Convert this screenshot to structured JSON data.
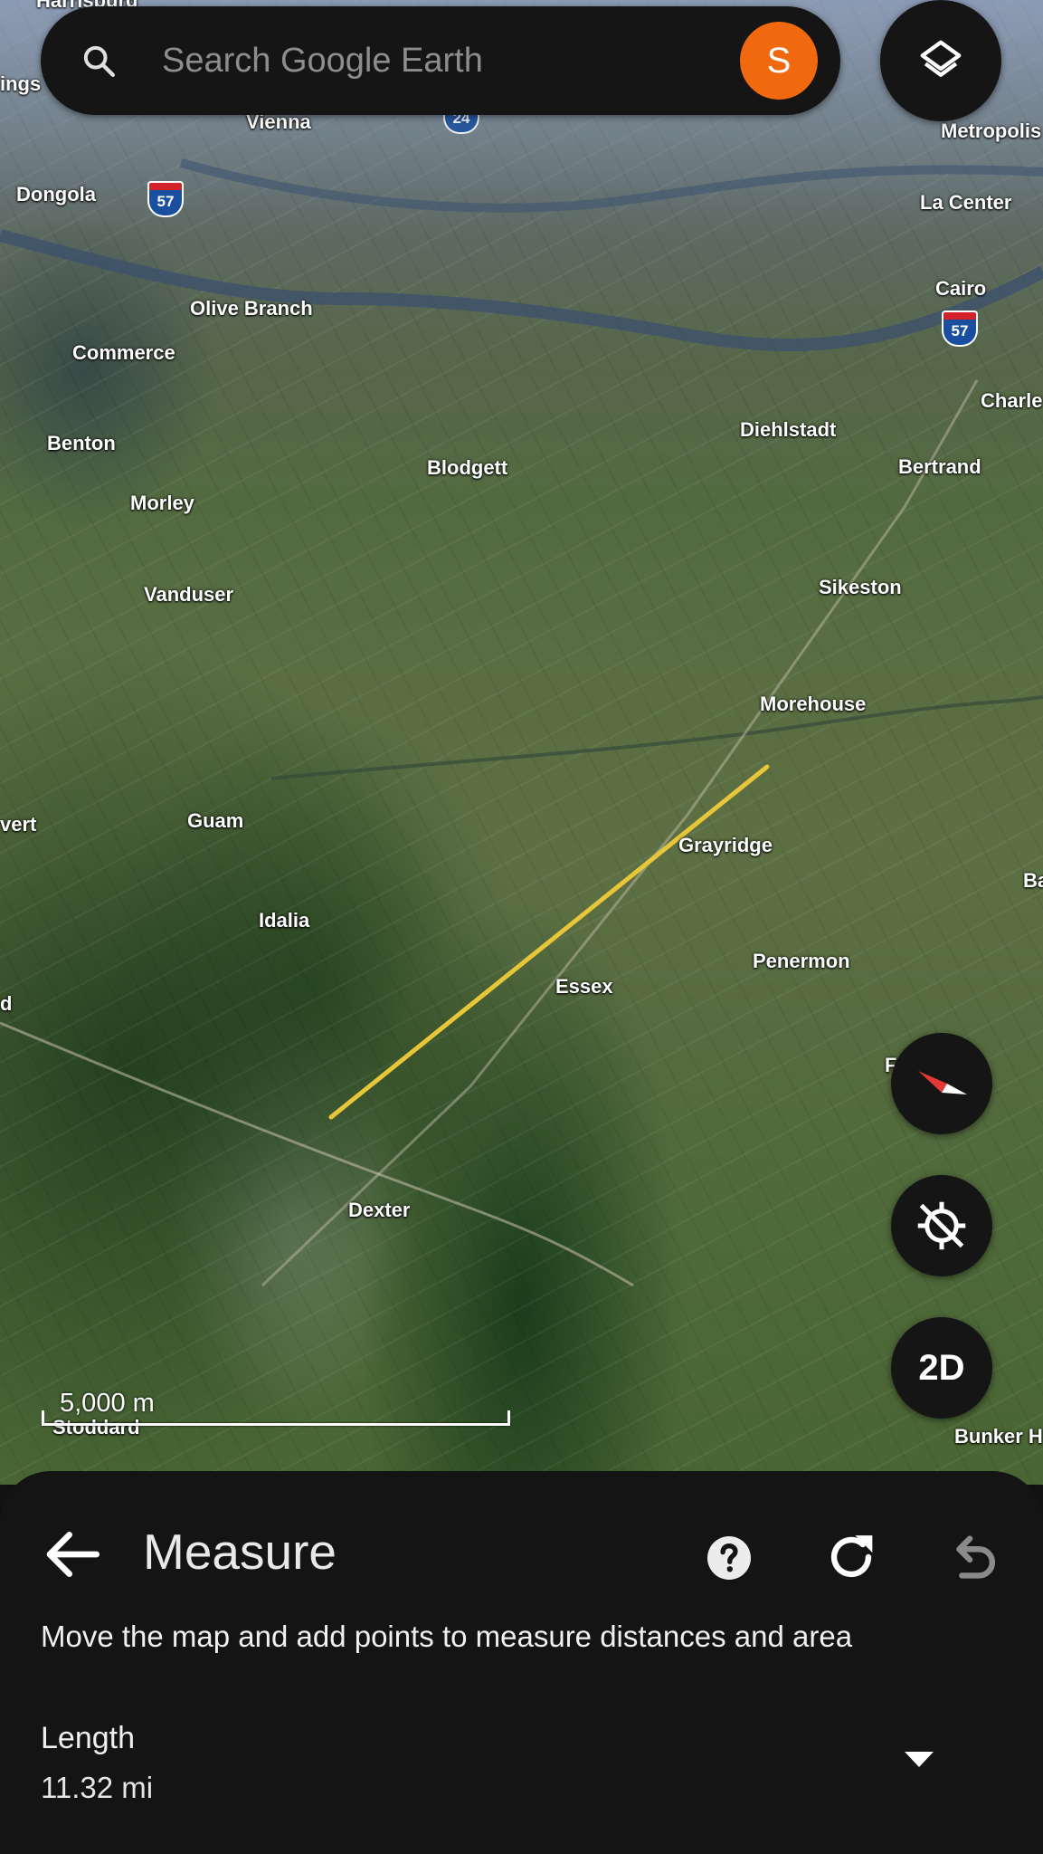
{
  "search": {
    "placeholder": "Search Google Earth",
    "avatar_initial": "S"
  },
  "map": {
    "places": [
      {
        "name": "Harrisburg"
      },
      {
        "name": "ings"
      },
      {
        "name": "Vienna"
      },
      {
        "name": "Metropolis"
      },
      {
        "name": "Dongola"
      },
      {
        "name": "La Center"
      },
      {
        "name": "Cairo"
      },
      {
        "name": "Olive Branch"
      },
      {
        "name": "Commerce"
      },
      {
        "name": "Charle"
      },
      {
        "name": "Diehlstadt"
      },
      {
        "name": "Benton"
      },
      {
        "name": "Blodgett"
      },
      {
        "name": "Bertrand"
      },
      {
        "name": "Morley"
      },
      {
        "name": "Sikeston"
      },
      {
        "name": "Vanduser"
      },
      {
        "name": "Morehouse"
      },
      {
        "name": "vert"
      },
      {
        "name": "Guam"
      },
      {
        "name": "Grayridge"
      },
      {
        "name": "Ba"
      },
      {
        "name": "Idalia"
      },
      {
        "name": "Penermon"
      },
      {
        "name": "Essex"
      },
      {
        "name": "d"
      },
      {
        "name": "F"
      },
      {
        "name": "Dexter"
      },
      {
        "name": "Stoddard"
      },
      {
        "name": "Bunker H"
      }
    ],
    "highway_shields": [
      "57",
      "57",
      "24"
    ],
    "scale_label": "5,000 m",
    "view_mode_label": "2D",
    "measure_line_color": "#e8c63a"
  },
  "sheet": {
    "title": "Measure",
    "instructions": "Move the map and add points to measure distances and area",
    "length_label": "Length",
    "length_value": "11.32 mi"
  },
  "colors": {
    "avatar": "#f0690f",
    "panel": "#141414",
    "compass_needle": "#e53935"
  }
}
